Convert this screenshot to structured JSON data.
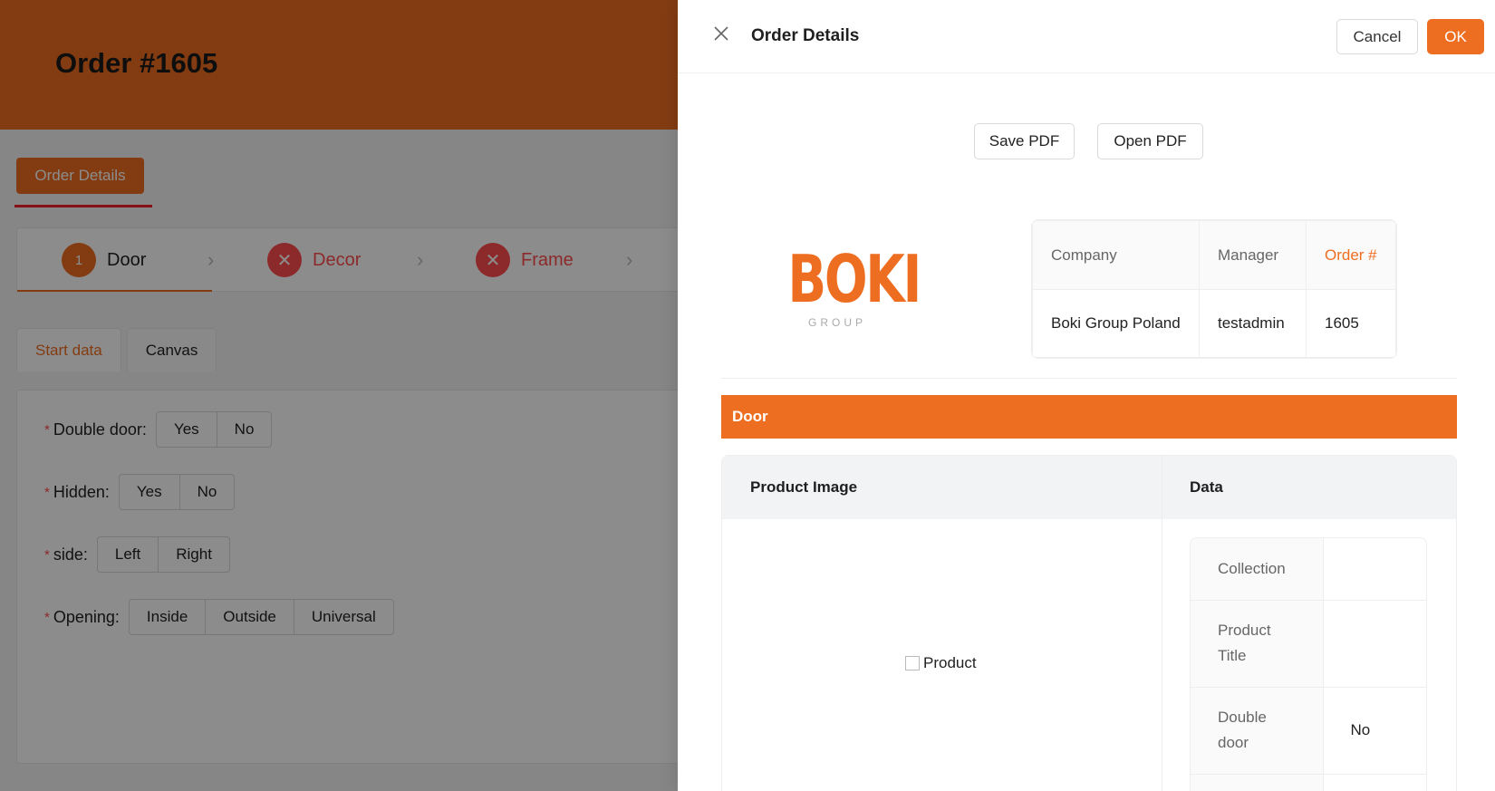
{
  "background": {
    "order_title": "Order #1605",
    "order_details_button": "Order Details",
    "steps": [
      {
        "num": "1",
        "label": "Door",
        "state": "active"
      },
      {
        "num": "✕",
        "label": "Decor",
        "state": "error"
      },
      {
        "num": "✕",
        "label": "Frame",
        "state": "error"
      }
    ],
    "tabs": [
      {
        "label": "Start data",
        "active": true
      },
      {
        "label": "Canvas",
        "active": false
      }
    ],
    "form": {
      "double_door": {
        "label": "Double door",
        "options": [
          "Yes",
          "No"
        ]
      },
      "hidden": {
        "label": "Hidden",
        "options": [
          "Yes",
          "No"
        ]
      },
      "side": {
        "label": "side",
        "options": [
          "Left",
          "Right"
        ]
      },
      "opening": {
        "label": "Opening",
        "options": [
          "Inside",
          "Outside",
          "Universal"
        ]
      }
    }
  },
  "drawer": {
    "title": "Order Details",
    "cancel_label": "Cancel",
    "ok_label": "OK",
    "save_pdf_label": "Save PDF",
    "open_pdf_label": "Open PDF",
    "logo": {
      "word": "BOKI",
      "sub": "GROUP"
    },
    "info_table": {
      "headers": {
        "company": "Company",
        "manager": "Manager",
        "order": "Order #"
      },
      "row": {
        "company": "Boki Group Poland",
        "manager": "testadmin",
        "order": "1605"
      }
    },
    "section_title": "Door",
    "product_table": {
      "col_image": "Product Image",
      "col_data": "Data",
      "image_alt": "Product",
      "rows": [
        {
          "label": "Collection",
          "value": ""
        },
        {
          "label": "Product Title",
          "value": ""
        },
        {
          "label": "Double door",
          "value": "No"
        }
      ]
    }
  },
  "colors": {
    "accent": "#ee6e21",
    "error": "#ff4d4f"
  }
}
